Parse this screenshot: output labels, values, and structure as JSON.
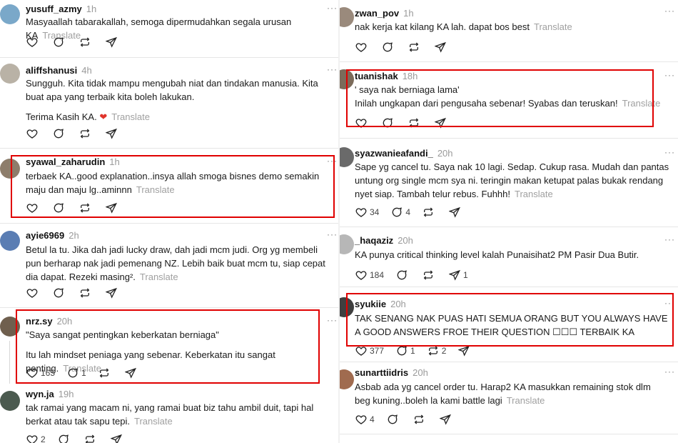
{
  "translate_label": "Translate",
  "left_posts": [
    {
      "user": "yusuff_azmy",
      "time": "1h",
      "lines": [
        "Masyaallah tabarakallah, semoga dipermudahkan segala urusan KA"
      ],
      "counts": {
        "like": "",
        "reply": "",
        "repost": "",
        "share": ""
      }
    },
    {
      "user": "aliffshanusi",
      "time": "4h",
      "lines": [
        "Sungguh. Kita tidak mampu mengubah niat dan tindakan manusia. Kita buat apa yang terbaik kita boleh lakukan.",
        "Terima Kasih KA. ❤"
      ],
      "counts": {
        "like": "",
        "reply": "",
        "repost": "",
        "share": ""
      }
    },
    {
      "user": "syawal_zaharudin",
      "time": "1h",
      "lines": [
        "terbaek KA..good explanation..insya allah smoga bisnes demo semakin maju dan maju lg..aminnn"
      ],
      "counts": {
        "like": "",
        "reply": "",
        "repost": "",
        "share": ""
      }
    },
    {
      "user": "ayie6969",
      "time": "2h",
      "lines": [
        "Betul la tu. Jika dah jadi lucky draw, dah jadi mcm judi. Org yg membeli pun berharap nak jadi pemenang NZ. Lebih baik buat mcm tu, siap cepat dia dapat. Rezeki masing²."
      ],
      "counts": {
        "like": "",
        "reply": "",
        "repost": "",
        "share": ""
      }
    },
    {
      "user": "nrz.sy",
      "time": "20h",
      "lines": [
        "\"Saya sangat pentingkan keberkatan berniaga\"",
        "Itu lah mindset peniaga yang sebenar. Keberkatan itu sangat penting."
      ],
      "counts": {
        "like": "165",
        "reply": "1",
        "repost": "",
        "share": ""
      }
    },
    {
      "user": "wyn.ja",
      "time": "19h",
      "lines": [
        "tak ramai yang macam ni, yang ramai buat biz tahu ambil duit, tapi hal berkat atau tak sapu tepi."
      ],
      "counts": {
        "like": "2",
        "reply": "",
        "repost": "",
        "share": ""
      }
    }
  ],
  "right_posts": [
    {
      "user": "zwan_pov",
      "time": "1h",
      "lines": [
        "nak kerja kat kilang KA lah. dapat bos best"
      ],
      "counts": {
        "like": "",
        "reply": "",
        "repost": "",
        "share": ""
      }
    },
    {
      "user": "tuanishak",
      "time": "18h",
      "lines": [
        "' saya nak berniaga lama'",
        "Inilah ungkapan dari pengusaha sebenar! Syabas dan teruskan!"
      ],
      "counts": {
        "like": "",
        "reply": "",
        "repost": "",
        "share": ""
      }
    },
    {
      "user": "syazwanieafandi_",
      "time": "20h",
      "lines": [
        "Sape yg cancel tu. Saya nak 10 lagi. Sedap. Cukup rasa. Mudah dan pantas untung org single mcm sya ni. teringin makan ketupat palas bukak rendang nyet siap. Tambah telur rebus. Fuhhh!"
      ],
      "counts": {
        "like": "34",
        "reply": "4",
        "repost": "",
        "share": ""
      }
    },
    {
      "user": "_haqaziz",
      "time": "20h",
      "lines": [
        "KA punya critical thinking level kalah Punaisihat2 PM Pasir Dua Butir."
      ],
      "counts": {
        "like": "184",
        "reply": "",
        "repost": "",
        "share": "1"
      }
    },
    {
      "user": "syukiie",
      "time": "20h",
      "lines": [
        "TAK SENANG NAK PUAS HATI SEMUA ORANG BUT YOU ALWAYS HAVE A GOOD ANSWERS FROE THEIR QUESTION ☐☐☐ TERBAIK KA"
      ],
      "counts": {
        "like": "377",
        "reply": "1",
        "repost": "2",
        "share": ""
      }
    },
    {
      "user": "sunarttiidris",
      "time": "20h",
      "lines": [
        "Asbab ada yg cancel order tu. Harap2 KA masukkan remaining stok dlm beg kuning..boleh la kami battle lagi"
      ],
      "counts": {
        "like": "4",
        "reply": "",
        "repost": "",
        "share": ""
      }
    }
  ],
  "colors": {
    "highlight": "#e00000",
    "heart": "#e0342b",
    "muted": "#a0a0a0",
    "separator": "#e6e6e6"
  },
  "icons": [
    "heart-icon",
    "reply-icon",
    "repost-icon",
    "share-icon",
    "more-icon"
  ]
}
